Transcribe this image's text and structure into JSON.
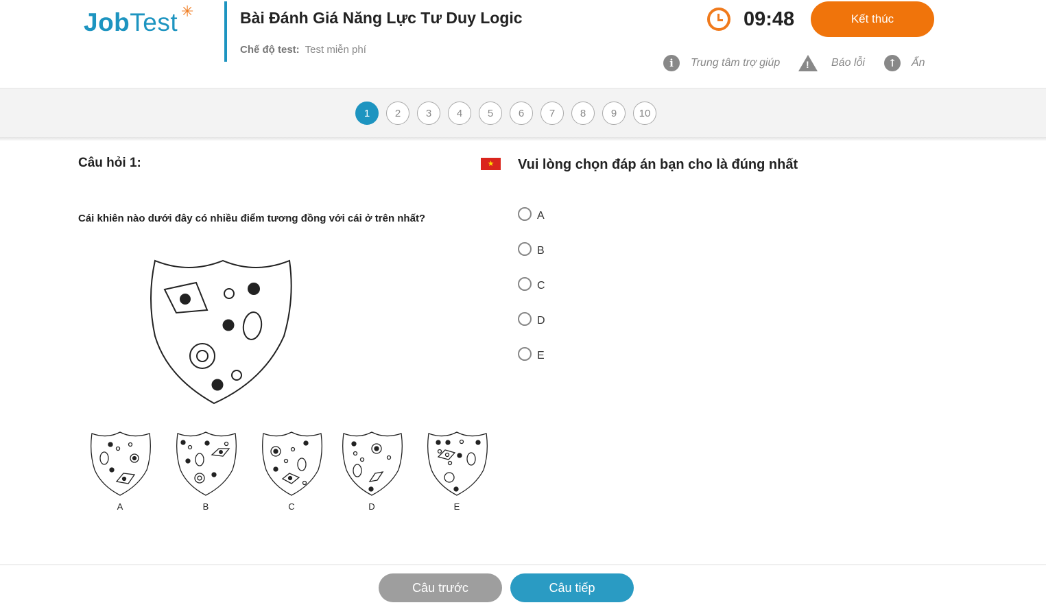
{
  "header": {
    "logo_bold": "Job",
    "logo_thin": "Test",
    "title": "Bài Đánh Giá Năng Lực Tư Duy Logic",
    "mode_label": "Chế độ test:",
    "mode_value": "Test miễn phí",
    "timer": "09:48",
    "finish_label": "Kết thúc",
    "tools": {
      "help": "Trung tâm trợ giúp",
      "report": "Báo lỗi",
      "hide": "Ẩn"
    }
  },
  "question_nav": {
    "numbers": [
      "1",
      "2",
      "3",
      "4",
      "5",
      "6",
      "7",
      "8",
      "9",
      "10"
    ],
    "active": "1"
  },
  "question": {
    "label": "Câu hỏi 1:",
    "text": "Cái khiên nào dưới đây có nhiều điểm tương đồng với cái ở trên nhất?",
    "figure_labels": [
      "A",
      "B",
      "C",
      "D",
      "E"
    ]
  },
  "answers": {
    "instruction": "Vui lòng chọn đáp án bạn cho là đúng nhất",
    "options": [
      "A",
      "B",
      "C",
      "D",
      "E"
    ]
  },
  "footer": {
    "prev_label": "Câu trước",
    "next_label": "Câu tiếp"
  },
  "colors": {
    "brand_blue": "#1d94c0",
    "accent_orange": "#f0740b"
  }
}
